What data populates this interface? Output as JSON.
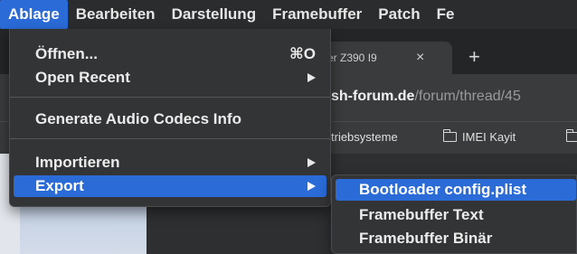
{
  "menubar": {
    "items": [
      "Ablage",
      "Bearbeiten",
      "Darstellung",
      "Framebuffer",
      "Patch",
      "Fe"
    ],
    "active_index": 0
  },
  "browser": {
    "tab_title": "er Z390 I9",
    "tab_close": "×",
    "new_tab": "+",
    "url_main": "sh-forum.de",
    "url_path": "/forum/thread/45",
    "bookmarks": [
      "triebsysteme",
      "IMEI Kayit"
    ]
  },
  "menu": {
    "open": {
      "label": "Öffnen...",
      "shortcut": "⌘O"
    },
    "open_recent": "Open Recent",
    "generate_audio": "Generate Audio Codecs Info",
    "importieren": "Importieren",
    "export": "Export"
  },
  "submenu": {
    "items": [
      "Bootloader config.plist",
      "Framebuffer Text",
      "Framebuffer Binär"
    ],
    "highlighted_index": 0
  },
  "colors": {
    "highlight": "#2a6bd8",
    "menu_bg": "#333436",
    "menubar_bg": "#2b2c2e"
  }
}
